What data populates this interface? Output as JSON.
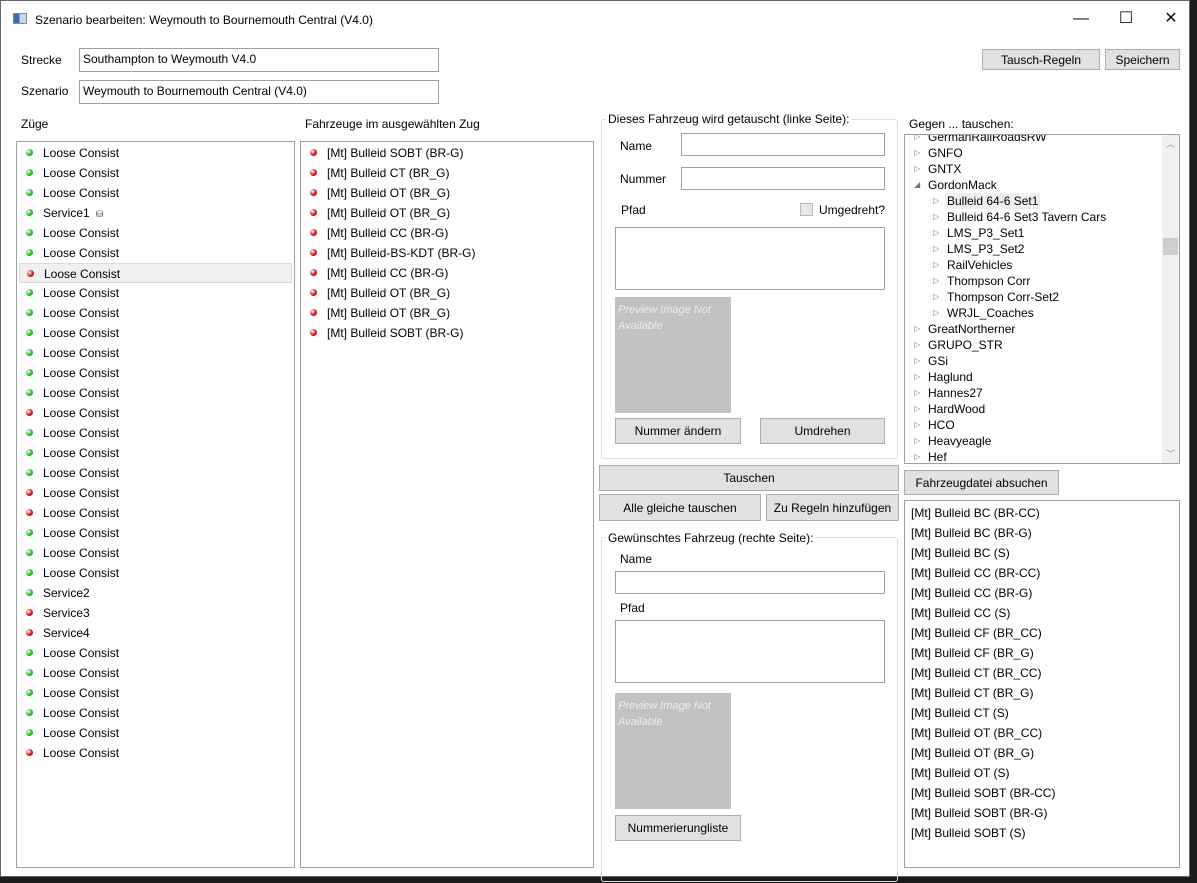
{
  "window": {
    "title": "Szenario bearbeiten: Weymouth to Bournemouth Central (V4.0)",
    "minimize": "—",
    "maximize": "☐",
    "close": "✕"
  },
  "header": {
    "strecke_label": "Strecke",
    "strecke_value": "Southampton to Weymouth V4.0",
    "szenario_label": "Szenario",
    "szenario_value": "Weymouth to Bournemouth Central (V4.0)",
    "tausch_regeln": "Tausch-Regeln",
    "speichern": "Speichern"
  },
  "trains": {
    "label": "Züge",
    "items": [
      {
        "name": "Loose Consist",
        "status": "green"
      },
      {
        "name": "Loose Consist",
        "status": "green"
      },
      {
        "name": "Loose Consist",
        "status": "green"
      },
      {
        "name": "Service1",
        "status": "green",
        "badge": "⛁"
      },
      {
        "name": "Loose Consist",
        "status": "green"
      },
      {
        "name": "Loose Consist",
        "status": "green"
      },
      {
        "name": "Loose Consist",
        "status": "red",
        "selected": true
      },
      {
        "name": "Loose Consist",
        "status": "green"
      },
      {
        "name": "Loose Consist",
        "status": "green"
      },
      {
        "name": "Loose Consist",
        "status": "green"
      },
      {
        "name": "Loose Consist",
        "status": "green"
      },
      {
        "name": "Loose Consist",
        "status": "green"
      },
      {
        "name": "Loose Consist",
        "status": "green"
      },
      {
        "name": "Loose Consist",
        "status": "red"
      },
      {
        "name": "Loose Consist",
        "status": "green"
      },
      {
        "name": "Loose Consist",
        "status": "green"
      },
      {
        "name": "Loose Consist",
        "status": "green"
      },
      {
        "name": "Loose Consist",
        "status": "red"
      },
      {
        "name": "Loose Consist",
        "status": "red"
      },
      {
        "name": "Loose Consist",
        "status": "green"
      },
      {
        "name": "Loose Consist",
        "status": "green"
      },
      {
        "name": "Loose Consist",
        "status": "green"
      },
      {
        "name": "Service2",
        "status": "green"
      },
      {
        "name": "Service3",
        "status": "red"
      },
      {
        "name": "Service4",
        "status": "red"
      },
      {
        "name": "Loose Consist",
        "status": "green"
      },
      {
        "name": "Loose Consist",
        "status": "green"
      },
      {
        "name": "Loose Consist",
        "status": "green"
      },
      {
        "name": "Loose Consist",
        "status": "green"
      },
      {
        "name": "Loose Consist",
        "status": "green"
      },
      {
        "name": "Loose Consist",
        "status": "red"
      }
    ]
  },
  "vehicles": {
    "label": "Fahrzeuge im ausgewählten Zug",
    "items": [
      {
        "name": "[Mt] Bulleid SOBT (BR-G)",
        "status": "red"
      },
      {
        "name": "[Mt] Bulleid CT (BR_G)",
        "status": "red"
      },
      {
        "name": "[Mt] Bulleid OT (BR_G)",
        "status": "red"
      },
      {
        "name": "[Mt] Bulleid OT (BR_G)",
        "status": "red"
      },
      {
        "name": "[Mt] Bulleid CC (BR-G)",
        "status": "red"
      },
      {
        "name": "[Mt] Bulleid-BS-KDT (BR-G)",
        "status": "red"
      },
      {
        "name": "[Mt] Bulleid CC (BR-G)",
        "status": "red"
      },
      {
        "name": "[Mt] Bulleid OT (BR_G)",
        "status": "red"
      },
      {
        "name": "[Mt] Bulleid OT (BR_G)",
        "status": "red"
      },
      {
        "name": "[Mt] Bulleid SOBT (BR-G)",
        "status": "red"
      }
    ]
  },
  "left_side": {
    "title": "Dieses Fahrzeug wird getauscht (linke Seite):",
    "name_label": "Name",
    "name_value": "",
    "nummer_label": "Nummer",
    "nummer_value": "",
    "pfad_label": "Pfad",
    "pfad_value": "",
    "umgedreht_label": "Umgedreht?",
    "umgedreht_checked": false,
    "preview": "Preview Image Not Available",
    "nummer_aendern": "Nummer ändern",
    "umdrehen": "Umdrehen"
  },
  "actions": {
    "tauschen": "Tauschen",
    "alle_gleiche": "Alle gleiche tauschen",
    "zu_regeln": "Zu Regeln hinzufügen"
  },
  "right_side": {
    "title": "Gewünschtes Fahrzeug (rechte Seite):",
    "name_label": "Name",
    "name_value": "",
    "pfad_label": "Pfad",
    "pfad_value": "",
    "preview": "Preview Image Not Available",
    "nummerierungliste": "Nummerierungliste"
  },
  "tree": {
    "label": "Gegen ... tauschen:",
    "items": [
      {
        "text": "GermanRailRoadsRW",
        "level": 0,
        "expanded": false
      },
      {
        "text": "GNFO",
        "level": 0,
        "expanded": false
      },
      {
        "text": "GNTX",
        "level": 0,
        "expanded": false
      },
      {
        "text": "GordonMack",
        "level": 0,
        "expanded": true
      },
      {
        "text": "Bulleid 64-6 Set1",
        "level": 1,
        "expanded": false,
        "selected": true
      },
      {
        "text": "Bulleid 64-6 Set3 Tavern Cars",
        "level": 1,
        "expanded": false
      },
      {
        "text": "LMS_P3_Set1",
        "level": 1,
        "expanded": false
      },
      {
        "text": "LMS_P3_Set2",
        "level": 1,
        "expanded": false
      },
      {
        "text": "RailVehicles",
        "level": 1,
        "expanded": false
      },
      {
        "text": "Thompson Corr",
        "level": 1,
        "expanded": false
      },
      {
        "text": "Thompson Corr-Set2",
        "level": 1,
        "expanded": false
      },
      {
        "text": "WRJL_Coaches",
        "level": 1,
        "expanded": false
      },
      {
        "text": "GreatNortherner",
        "level": 0,
        "expanded": false
      },
      {
        "text": "GRUPO_STR",
        "level": 0,
        "expanded": false
      },
      {
        "text": "GSi",
        "level": 0,
        "expanded": false
      },
      {
        "text": "Haglund",
        "level": 0,
        "expanded": false
      },
      {
        "text": "Hannes27",
        "level": 0,
        "expanded": false
      },
      {
        "text": "HardWood",
        "level": 0,
        "expanded": false
      },
      {
        "text": "HCO",
        "level": 0,
        "expanded": false
      },
      {
        "text": "Heavyeagle",
        "level": 0,
        "expanded": false
      },
      {
        "text": "Hef",
        "level": 0,
        "expanded": false
      }
    ]
  },
  "search_button": "Fahrzeugdatei absuchen",
  "candidates": [
    "[Mt] Bulleid BC (BR-CC)",
    "[Mt] Bulleid BC (BR-G)",
    "[Mt] Bulleid BC (S)",
    "[Mt] Bulleid CC (BR-CC)",
    "[Mt] Bulleid CC (BR-G)",
    "[Mt] Bulleid CC (S)",
    "[Mt] Bulleid CF (BR_CC)",
    "[Mt] Bulleid CF (BR_G)",
    "[Mt] Bulleid CT (BR_CC)",
    "[Mt] Bulleid CT (BR_G)",
    "[Mt] Bulleid CT (S)",
    "[Mt] Bulleid OT (BR_CC)",
    "[Mt] Bulleid OT (BR_G)",
    "[Mt] Bulleid OT (S)",
    "[Mt] Bulleid SOBT (BR-CC)",
    "[Mt] Bulleid SOBT (BR-G)",
    "[Mt] Bulleid SOBT (S)"
  ],
  "colors": {
    "green": "#22b422",
    "red": "#d01010"
  }
}
